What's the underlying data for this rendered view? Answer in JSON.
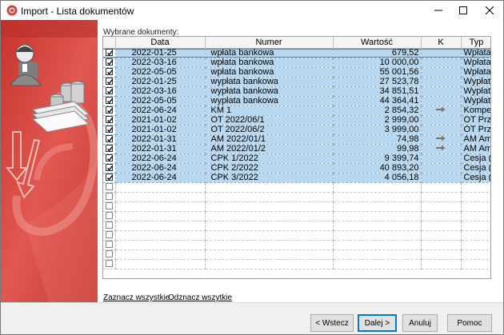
{
  "window": {
    "title": "Import - Lista dokumentów"
  },
  "label_selected": "Wybrane dokumenty:",
  "columns": [
    "Data",
    "Numer",
    "Wartość",
    "K",
    "Typ"
  ],
  "rows": [
    {
      "checked": true,
      "date": "2022-01-25",
      "number": "wpłata bankowa",
      "amount": "679,52",
      "k": "",
      "type": "Wpłata"
    },
    {
      "checked": true,
      "date": "2022-03-16",
      "number": "wpłata bankowa",
      "amount": "10 000,00",
      "k": "",
      "type": "Wpłata"
    },
    {
      "checked": true,
      "date": "2022-05-05",
      "number": "wpłata bankowa",
      "amount": "55 001,56",
      "k": "",
      "type": "Wpłata"
    },
    {
      "checked": true,
      "date": "2022-01-25",
      "number": "wypłata bankowa",
      "amount": "27 523,78",
      "k": "",
      "type": "Wypłat"
    },
    {
      "checked": true,
      "date": "2022-03-16",
      "number": "wypłata bankowa",
      "amount": "34 851,51",
      "k": "",
      "type": "Wypłat"
    },
    {
      "checked": true,
      "date": "2022-05-05",
      "number": "wypłata bankowa",
      "amount": "44 364,41",
      "k": "",
      "type": "Wypłat"
    },
    {
      "checked": true,
      "date": "2022-06-24",
      "number": "KM 1",
      "amount": "2 854,32",
      "k": "arrow-right-icon",
      "type": "Kompe"
    },
    {
      "checked": true,
      "date": "2021-01-02",
      "number": "OT 2022/06/1",
      "amount": "2 999,00",
      "k": "",
      "type": "OT Prz"
    },
    {
      "checked": true,
      "date": "2021-01-02",
      "number": "OT 2022/06/2",
      "amount": "3 999,00",
      "k": "",
      "type": "OT Prz"
    },
    {
      "checked": true,
      "date": "2022-01-31",
      "number": "AM 2022/01/1",
      "amount": "74,98",
      "k": "arrow-right-icon",
      "type": "AM Am"
    },
    {
      "checked": true,
      "date": "2022-01-31",
      "number": "AM 2022/01/2",
      "amount": "99,98",
      "k": "arrow-right-icon",
      "type": "AM Am"
    },
    {
      "checked": true,
      "date": "2022-06-24",
      "number": "CPK 1/2022",
      "amount": "9 399,74",
      "k": "",
      "type": "Cesja ("
    },
    {
      "checked": true,
      "date": "2022-06-24",
      "number": "CPK 2/2022",
      "amount": "40 893,20",
      "k": "",
      "type": "Cesja ("
    },
    {
      "checked": true,
      "date": "2022-06-24",
      "number": "CPK 3/2022",
      "amount": "4 056,18",
      "k": "",
      "type": "Cesja ("
    }
  ],
  "empty_rows": 9,
  "links": {
    "select_all": "Zaznacz wszystkie",
    "deselect_all": "Odznacz wszytkie"
  },
  "buttons": {
    "back": "< Wstecz",
    "next": "Dalej >",
    "cancel": "Anuluj",
    "help": "Pomoc"
  },
  "colors": {
    "selected_row": "#b8d8f2",
    "focus_border": "#3c8ad8",
    "side_panel": "#d9413a"
  }
}
